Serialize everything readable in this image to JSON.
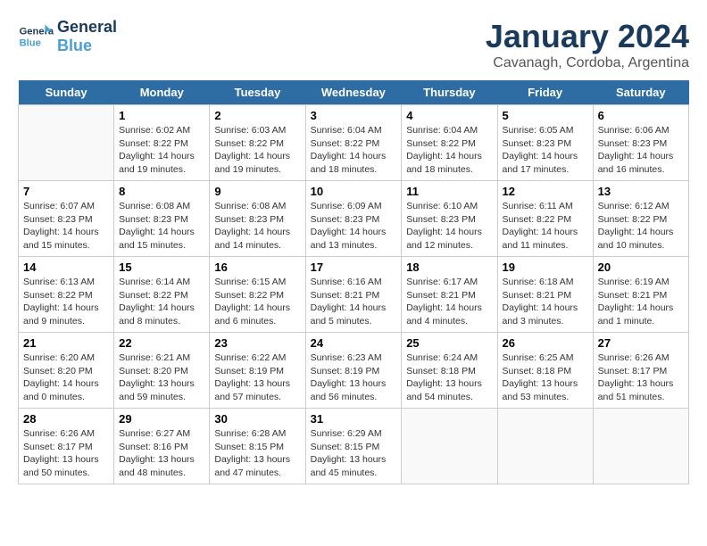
{
  "header": {
    "logo_line1": "General",
    "logo_line2": "Blue",
    "month": "January 2024",
    "location": "Cavanagh, Cordoba, Argentina"
  },
  "days": [
    "Sunday",
    "Monday",
    "Tuesday",
    "Wednesday",
    "Thursday",
    "Friday",
    "Saturday"
  ],
  "weeks": [
    [
      {
        "date": "",
        "text": ""
      },
      {
        "date": "1",
        "text": "Sunrise: 6:02 AM\nSunset: 8:22 PM\nDaylight: 14 hours and 19 minutes."
      },
      {
        "date": "2",
        "text": "Sunrise: 6:03 AM\nSunset: 8:22 PM\nDaylight: 14 hours and 19 minutes."
      },
      {
        "date": "3",
        "text": "Sunrise: 6:04 AM\nSunset: 8:22 PM\nDaylight: 14 hours and 18 minutes."
      },
      {
        "date": "4",
        "text": "Sunrise: 6:04 AM\nSunset: 8:22 PM\nDaylight: 14 hours and 18 minutes."
      },
      {
        "date": "5",
        "text": "Sunrise: 6:05 AM\nSunset: 8:23 PM\nDaylight: 14 hours and 17 minutes."
      },
      {
        "date": "6",
        "text": "Sunrise: 6:06 AM\nSunset: 8:23 PM\nDaylight: 14 hours and 16 minutes."
      }
    ],
    [
      {
        "date": "7",
        "text": "Sunrise: 6:07 AM\nSunset: 8:23 PM\nDaylight: 14 hours and 15 minutes."
      },
      {
        "date": "8",
        "text": "Sunrise: 6:08 AM\nSunset: 8:23 PM\nDaylight: 14 hours and 15 minutes."
      },
      {
        "date": "9",
        "text": "Sunrise: 6:08 AM\nSunset: 8:23 PM\nDaylight: 14 hours and 14 minutes."
      },
      {
        "date": "10",
        "text": "Sunrise: 6:09 AM\nSunset: 8:23 PM\nDaylight: 14 hours and 13 minutes."
      },
      {
        "date": "11",
        "text": "Sunrise: 6:10 AM\nSunset: 8:23 PM\nDaylight: 14 hours and 12 minutes."
      },
      {
        "date": "12",
        "text": "Sunrise: 6:11 AM\nSunset: 8:22 PM\nDaylight: 14 hours and 11 minutes."
      },
      {
        "date": "13",
        "text": "Sunrise: 6:12 AM\nSunset: 8:22 PM\nDaylight: 14 hours and 10 minutes."
      }
    ],
    [
      {
        "date": "14",
        "text": "Sunrise: 6:13 AM\nSunset: 8:22 PM\nDaylight: 14 hours and 9 minutes."
      },
      {
        "date": "15",
        "text": "Sunrise: 6:14 AM\nSunset: 8:22 PM\nDaylight: 14 hours and 8 minutes."
      },
      {
        "date": "16",
        "text": "Sunrise: 6:15 AM\nSunset: 8:22 PM\nDaylight: 14 hours and 6 minutes."
      },
      {
        "date": "17",
        "text": "Sunrise: 6:16 AM\nSunset: 8:21 PM\nDaylight: 14 hours and 5 minutes."
      },
      {
        "date": "18",
        "text": "Sunrise: 6:17 AM\nSunset: 8:21 PM\nDaylight: 14 hours and 4 minutes."
      },
      {
        "date": "19",
        "text": "Sunrise: 6:18 AM\nSunset: 8:21 PM\nDaylight: 14 hours and 3 minutes."
      },
      {
        "date": "20",
        "text": "Sunrise: 6:19 AM\nSunset: 8:21 PM\nDaylight: 14 hours and 1 minute."
      }
    ],
    [
      {
        "date": "21",
        "text": "Sunrise: 6:20 AM\nSunset: 8:20 PM\nDaylight: 14 hours and 0 minutes."
      },
      {
        "date": "22",
        "text": "Sunrise: 6:21 AM\nSunset: 8:20 PM\nDaylight: 13 hours and 59 minutes."
      },
      {
        "date": "23",
        "text": "Sunrise: 6:22 AM\nSunset: 8:19 PM\nDaylight: 13 hours and 57 minutes."
      },
      {
        "date": "24",
        "text": "Sunrise: 6:23 AM\nSunset: 8:19 PM\nDaylight: 13 hours and 56 minutes."
      },
      {
        "date": "25",
        "text": "Sunrise: 6:24 AM\nSunset: 8:18 PM\nDaylight: 13 hours and 54 minutes."
      },
      {
        "date": "26",
        "text": "Sunrise: 6:25 AM\nSunset: 8:18 PM\nDaylight: 13 hours and 53 minutes."
      },
      {
        "date": "27",
        "text": "Sunrise: 6:26 AM\nSunset: 8:17 PM\nDaylight: 13 hours and 51 minutes."
      }
    ],
    [
      {
        "date": "28",
        "text": "Sunrise: 6:26 AM\nSunset: 8:17 PM\nDaylight: 13 hours and 50 minutes."
      },
      {
        "date": "29",
        "text": "Sunrise: 6:27 AM\nSunset: 8:16 PM\nDaylight: 13 hours and 48 minutes."
      },
      {
        "date": "30",
        "text": "Sunrise: 6:28 AM\nSunset: 8:15 PM\nDaylight: 13 hours and 47 minutes."
      },
      {
        "date": "31",
        "text": "Sunrise: 6:29 AM\nSunset: 8:15 PM\nDaylight: 13 hours and 45 minutes."
      },
      {
        "date": "",
        "text": ""
      },
      {
        "date": "",
        "text": ""
      },
      {
        "date": "",
        "text": ""
      }
    ]
  ]
}
